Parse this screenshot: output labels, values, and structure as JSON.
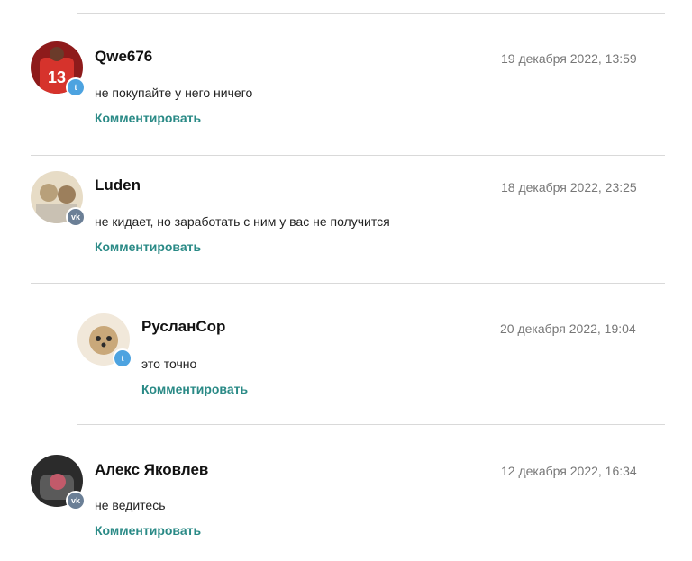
{
  "comments": [
    {
      "author": "Qwe676",
      "date": "19 декабря 2022, 13:59",
      "text": "не покупайте у него ничего",
      "reply_label": "Комментировать",
      "network": "twitter-icon",
      "avatar_colors": [
        "#8e1b1b",
        "#d6332c"
      ]
    },
    {
      "author": "Luden",
      "date": "18 декабря 2022, 23:25",
      "text": "не кидает, но заработать с ним у вас не получится",
      "reply_label": "Комментировать",
      "network": "vk-icon",
      "avatar_colors": [
        "#b8a07a",
        "#e7dcc6"
      ]
    },
    {
      "author": "РусланСор",
      "date": "20 декабря 2022, 19:04",
      "text": "это точно",
      "reply_label": "Комментировать",
      "network": "twitter-icon",
      "avatar_colors": [
        "#c9a87a",
        "#f1e8da"
      ]
    },
    {
      "author": "Алекс Яковлев",
      "date": "12 декабря 2022, 16:34",
      "text": "не ведитесь",
      "reply_label": "Комментировать",
      "network": "vk-icon",
      "avatar_colors": [
        "#2b2b2b",
        "#c25a6a"
      ]
    }
  ],
  "colors": {
    "link": "#2a8a86",
    "divider": "#d9d9d9",
    "twitter_badge": "#4da3e0",
    "vk_badge": "#6b7f96"
  }
}
